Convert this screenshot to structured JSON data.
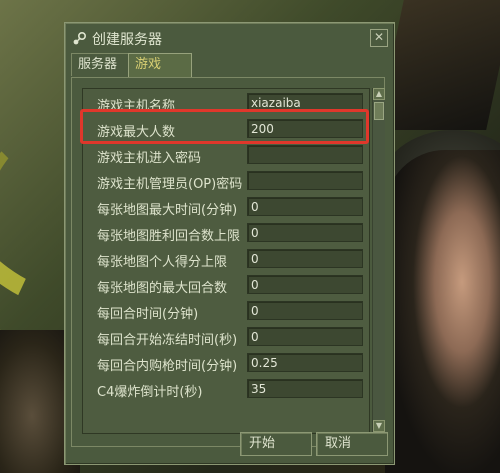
{
  "window": {
    "title": "创建服务器",
    "close_symbol": "✕"
  },
  "tabs": [
    {
      "label": "服务器",
      "active": false
    },
    {
      "label": "游戏",
      "active": true
    }
  ],
  "settings": [
    {
      "label": "游戏主机名称",
      "value": "xiazaiba"
    },
    {
      "label": "游戏最大人数",
      "value": "200"
    },
    {
      "label": "游戏主机进入密码",
      "value": ""
    },
    {
      "label": "游戏主机管理员(OP)密码",
      "value": ""
    },
    {
      "label": "每张地图最大时间(分钟)",
      "value": "0"
    },
    {
      "label": "每张地图胜利回合数上限",
      "value": "0"
    },
    {
      "label": "每张地图个人得分上限",
      "value": "0"
    },
    {
      "label": "每张地图的最大回合数",
      "value": "0"
    },
    {
      "label": "每回合时间(分钟)",
      "value": "0"
    },
    {
      "label": "每回合开始冻结时间(秒)",
      "value": "0"
    },
    {
      "label": "每回合内购枪时间(分钟)",
      "value": "0.25"
    },
    {
      "label": "C4爆炸倒计时(秒)",
      "value": "35"
    }
  ],
  "buttons": {
    "start": "开始",
    "cancel": "取消"
  },
  "icons": {
    "app": "steam-icon",
    "scroll_up": "▲",
    "scroll_down": "▼"
  },
  "colors": {
    "highlight": "#e0372b",
    "active_tab": "#d8cf73"
  }
}
